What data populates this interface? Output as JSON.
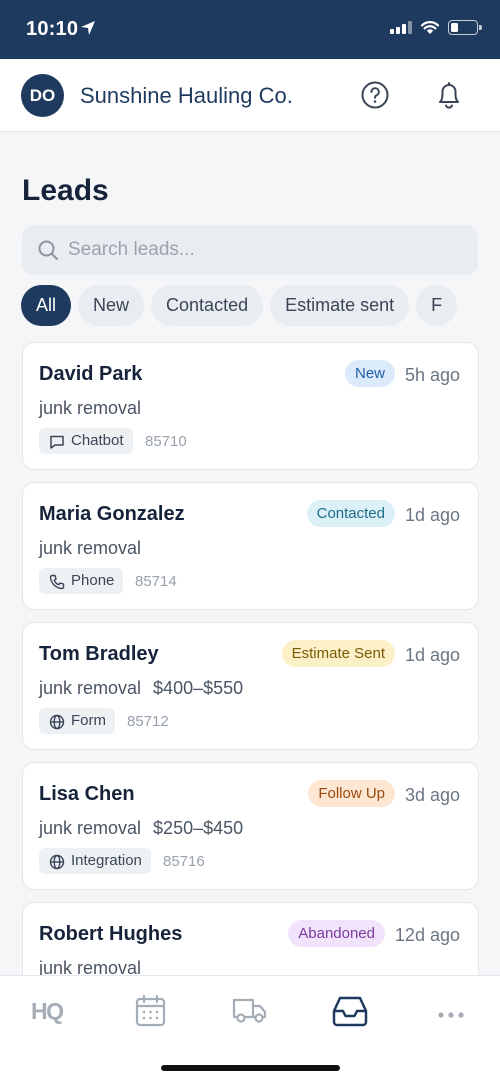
{
  "status_bar": {
    "time": "10:10"
  },
  "header": {
    "avatar_initials": "DO",
    "company_name": "Sunshine Hauling Co."
  },
  "page": {
    "title": "Leads",
    "search_placeholder": "Search leads..."
  },
  "filters": [
    "All",
    "New",
    "Contacted",
    "Estimate sent",
    "F"
  ],
  "active_filter": "All",
  "leads": [
    {
      "name": "David Park",
      "status": "New",
      "time": "5h ago",
      "service": "junk removal",
      "price": "",
      "source": "Chatbot",
      "source_icon": "chat-icon",
      "zip": "85710"
    },
    {
      "name": "Maria Gonzalez",
      "status": "Contacted",
      "time": "1d ago",
      "service": "junk removal",
      "price": "",
      "source": "Phone",
      "source_icon": "phone-icon",
      "zip": "85714"
    },
    {
      "name": "Tom Bradley",
      "status": "Estimate Sent",
      "time": "1d ago",
      "service": "junk removal",
      "price": "$400–$550",
      "source": "Form",
      "source_icon": "globe-icon",
      "zip": "85712"
    },
    {
      "name": "Lisa Chen",
      "status": "Follow Up",
      "time": "3d ago",
      "service": "junk removal",
      "price": "$250–$450",
      "source": "Integration",
      "source_icon": "globe-icon",
      "zip": "85716"
    },
    {
      "name": "Robert Hughes",
      "status": "Abandoned",
      "time": "12d ago",
      "service": "junk removal",
      "price": "",
      "source": "",
      "source_icon": "",
      "zip": ""
    }
  ],
  "status_colors": {
    "New": {
      "bg": "#dcebfb",
      "fg": "#1f5fa8"
    },
    "Contacted": {
      "bg": "#dcf0f8",
      "fg": "#1d6c86"
    },
    "Estimate Sent": {
      "bg": "#fcf0c7",
      "fg": "#7a5a06"
    },
    "Follow Up": {
      "bg": "#fde6d2",
      "fg": "#9a4a10"
    },
    "Abandoned": {
      "bg": "#f1e3fb",
      "fg": "#7a3b9e"
    }
  },
  "bottom_nav": {
    "items": [
      {
        "label": "HQ",
        "icon": "hq-icon"
      },
      {
        "label": "",
        "icon": "calendar-icon"
      },
      {
        "label": "",
        "icon": "truck-icon"
      },
      {
        "label": "",
        "icon": "inbox-icon",
        "active": true
      },
      {
        "label": "",
        "icon": "more-icon"
      }
    ]
  },
  "colors": {
    "brand": "#1f3a5f",
    "background": "#f5f6f8",
    "nav_inactive": "#a5adb7"
  }
}
